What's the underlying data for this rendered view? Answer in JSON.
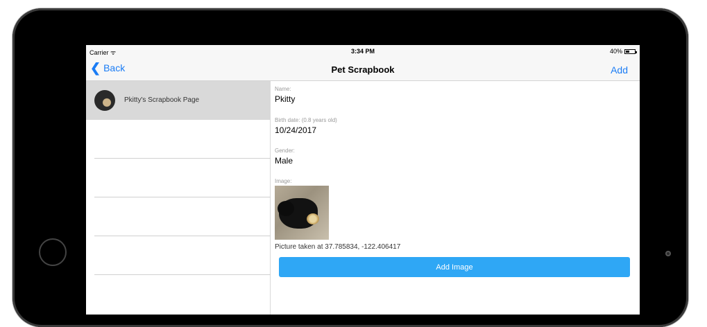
{
  "status_bar": {
    "carrier": "Carrier ᯤ",
    "time": "3:34 PM",
    "battery": "40%"
  },
  "nav": {
    "back_label": "Back",
    "title": "Pet Scrapbook",
    "add_label": "Add",
    "back_icon": "chevron-left-icon"
  },
  "list": {
    "items": [
      {
        "label": "Pkitty's Scrapbook Page",
        "selected": true
      }
    ]
  },
  "detail": {
    "name_label": "Name:",
    "name_value": "Pkitty",
    "birth_label": "Birth date: (0.8 years old)",
    "birth_value": "10/24/2017",
    "gender_label": "Gender:",
    "gender_value": "Male",
    "image_label": "Image:",
    "caption": "Picture taken at 37.785834, -122.406417",
    "add_image_label": "Add Image"
  },
  "colors": {
    "accent": "#1a7cf5",
    "button": "#2fa7f5",
    "selected_row": "#d9d9d9"
  }
}
